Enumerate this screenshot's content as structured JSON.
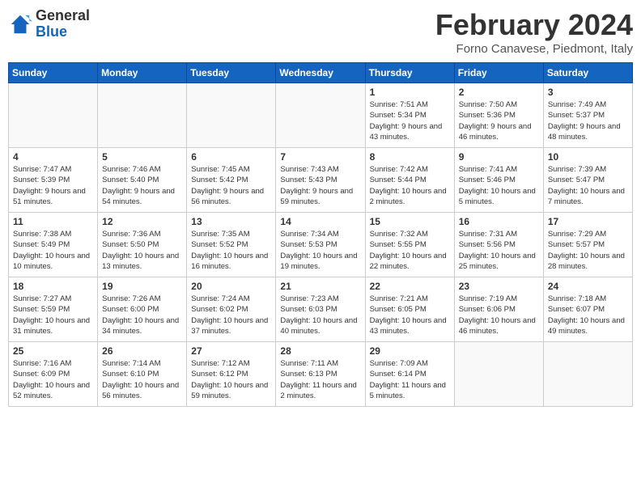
{
  "header": {
    "logo_general": "General",
    "logo_blue": "Blue",
    "month_title": "February 2024",
    "location": "Forno Canavese, Piedmont, Italy"
  },
  "days_of_week": [
    "Sunday",
    "Monday",
    "Tuesday",
    "Wednesday",
    "Thursday",
    "Friday",
    "Saturday"
  ],
  "weeks": [
    [
      {
        "day": "",
        "info": ""
      },
      {
        "day": "",
        "info": ""
      },
      {
        "day": "",
        "info": ""
      },
      {
        "day": "",
        "info": ""
      },
      {
        "day": "1",
        "info": "Sunrise: 7:51 AM\nSunset: 5:34 PM\nDaylight: 9 hours\nand 43 minutes."
      },
      {
        "day": "2",
        "info": "Sunrise: 7:50 AM\nSunset: 5:36 PM\nDaylight: 9 hours\nand 46 minutes."
      },
      {
        "day": "3",
        "info": "Sunrise: 7:49 AM\nSunset: 5:37 PM\nDaylight: 9 hours\nand 48 minutes."
      }
    ],
    [
      {
        "day": "4",
        "info": "Sunrise: 7:47 AM\nSunset: 5:39 PM\nDaylight: 9 hours\nand 51 minutes."
      },
      {
        "day": "5",
        "info": "Sunrise: 7:46 AM\nSunset: 5:40 PM\nDaylight: 9 hours\nand 54 minutes."
      },
      {
        "day": "6",
        "info": "Sunrise: 7:45 AM\nSunset: 5:42 PM\nDaylight: 9 hours\nand 56 minutes."
      },
      {
        "day": "7",
        "info": "Sunrise: 7:43 AM\nSunset: 5:43 PM\nDaylight: 9 hours\nand 59 minutes."
      },
      {
        "day": "8",
        "info": "Sunrise: 7:42 AM\nSunset: 5:44 PM\nDaylight: 10 hours\nand 2 minutes."
      },
      {
        "day": "9",
        "info": "Sunrise: 7:41 AM\nSunset: 5:46 PM\nDaylight: 10 hours\nand 5 minutes."
      },
      {
        "day": "10",
        "info": "Sunrise: 7:39 AM\nSunset: 5:47 PM\nDaylight: 10 hours\nand 7 minutes."
      }
    ],
    [
      {
        "day": "11",
        "info": "Sunrise: 7:38 AM\nSunset: 5:49 PM\nDaylight: 10 hours\nand 10 minutes."
      },
      {
        "day": "12",
        "info": "Sunrise: 7:36 AM\nSunset: 5:50 PM\nDaylight: 10 hours\nand 13 minutes."
      },
      {
        "day": "13",
        "info": "Sunrise: 7:35 AM\nSunset: 5:52 PM\nDaylight: 10 hours\nand 16 minutes."
      },
      {
        "day": "14",
        "info": "Sunrise: 7:34 AM\nSunset: 5:53 PM\nDaylight: 10 hours\nand 19 minutes."
      },
      {
        "day": "15",
        "info": "Sunrise: 7:32 AM\nSunset: 5:55 PM\nDaylight: 10 hours\nand 22 minutes."
      },
      {
        "day": "16",
        "info": "Sunrise: 7:31 AM\nSunset: 5:56 PM\nDaylight: 10 hours\nand 25 minutes."
      },
      {
        "day": "17",
        "info": "Sunrise: 7:29 AM\nSunset: 5:57 PM\nDaylight: 10 hours\nand 28 minutes."
      }
    ],
    [
      {
        "day": "18",
        "info": "Sunrise: 7:27 AM\nSunset: 5:59 PM\nDaylight: 10 hours\nand 31 minutes."
      },
      {
        "day": "19",
        "info": "Sunrise: 7:26 AM\nSunset: 6:00 PM\nDaylight: 10 hours\nand 34 minutes."
      },
      {
        "day": "20",
        "info": "Sunrise: 7:24 AM\nSunset: 6:02 PM\nDaylight: 10 hours\nand 37 minutes."
      },
      {
        "day": "21",
        "info": "Sunrise: 7:23 AM\nSunset: 6:03 PM\nDaylight: 10 hours\nand 40 minutes."
      },
      {
        "day": "22",
        "info": "Sunrise: 7:21 AM\nSunset: 6:05 PM\nDaylight: 10 hours\nand 43 minutes."
      },
      {
        "day": "23",
        "info": "Sunrise: 7:19 AM\nSunset: 6:06 PM\nDaylight: 10 hours\nand 46 minutes."
      },
      {
        "day": "24",
        "info": "Sunrise: 7:18 AM\nSunset: 6:07 PM\nDaylight: 10 hours\nand 49 minutes."
      }
    ],
    [
      {
        "day": "25",
        "info": "Sunrise: 7:16 AM\nSunset: 6:09 PM\nDaylight: 10 hours\nand 52 minutes."
      },
      {
        "day": "26",
        "info": "Sunrise: 7:14 AM\nSunset: 6:10 PM\nDaylight: 10 hours\nand 56 minutes."
      },
      {
        "day": "27",
        "info": "Sunrise: 7:12 AM\nSunset: 6:12 PM\nDaylight: 10 hours\nand 59 minutes."
      },
      {
        "day": "28",
        "info": "Sunrise: 7:11 AM\nSunset: 6:13 PM\nDaylight: 11 hours\nand 2 minutes."
      },
      {
        "day": "29",
        "info": "Sunrise: 7:09 AM\nSunset: 6:14 PM\nDaylight: 11 hours\nand 5 minutes."
      },
      {
        "day": "",
        "info": ""
      },
      {
        "day": "",
        "info": ""
      }
    ]
  ]
}
